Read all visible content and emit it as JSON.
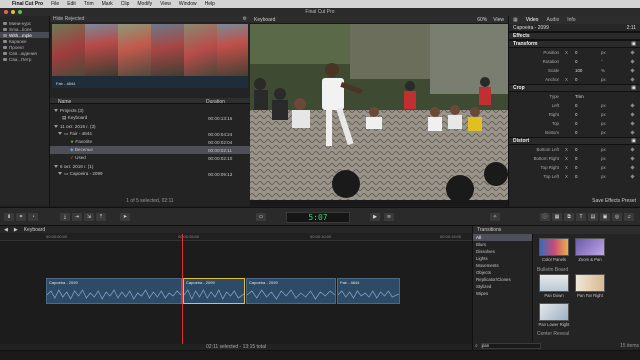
{
  "menubar": {
    "app": "Final Cut Pro",
    "items": [
      "File",
      "Edit",
      "Trim",
      "Mark",
      "Clip",
      "Modify",
      "View",
      "Window",
      "Help"
    ]
  },
  "window": {
    "title": "Final Cut Pro"
  },
  "sidebar": {
    "items": [
      "Мини-курс",
      "Sma...lions",
      "With...mple",
      "Караоке",
      "Проект",
      "Свя...ждения",
      "Сва...Петр"
    ]
  },
  "browser": {
    "header": "Hide Rejected",
    "filmstrip_label": "Fair - 4844",
    "columns": {
      "name": "Name",
      "duration": "Duration"
    },
    "rows": [
      {
        "name": "Projects (3)",
        "duration": ""
      },
      {
        "name": "Keyboard",
        "duration": "00:00:13:15"
      },
      {
        "name": "11 окт. 2016 г. (3)",
        "duration": ""
      },
      {
        "name": "Fair - 4844",
        "duration": "00:00:04:24"
      },
      {
        "name": "Favorite",
        "duration": "00:00:02:04"
      },
      {
        "name": "Веселье",
        "duration": "00:00:02:11"
      },
      {
        "name": "Used",
        "duration": "00:00:02:10"
      },
      {
        "name": "6 окт. 2016 г. (1)",
        "duration": ""
      },
      {
        "name": "Capoeira - 2099",
        "duration": "00:00:09:13"
      }
    ],
    "footer": "1 of 5 selected, 02:11"
  },
  "viewer": {
    "title": "Keyboard",
    "zoom": "60%",
    "view_label": "View"
  },
  "inspector": {
    "tabs": [
      "Video",
      "Audio",
      "Info"
    ],
    "clip_name": "Capoeira - 2099",
    "clip_duration": "2:11",
    "sections": {
      "effects": "Effects",
      "transform": "Transform",
      "crop": "Crop",
      "distort": "Distort"
    },
    "transform_params": [
      {
        "label": "Position",
        "axis": "X",
        "value": "0",
        "unit": "px"
      },
      {
        "label": "Rotation",
        "axis": "",
        "value": "0",
        "unit": "°"
      },
      {
        "label": "Scale",
        "axis": "",
        "value": "100",
        "unit": "%"
      },
      {
        "label": "Anchor",
        "axis": "X",
        "value": "0",
        "unit": "px"
      }
    ],
    "crop_params": [
      {
        "label": "Type",
        "axis": "",
        "value": "Trim",
        "unit": ""
      },
      {
        "label": "Left",
        "axis": "",
        "value": "0",
        "unit": "px"
      },
      {
        "label": "Right",
        "axis": "",
        "value": "0",
        "unit": "px"
      },
      {
        "label": "Top",
        "axis": "",
        "value": "0",
        "unit": "px"
      },
      {
        "label": "Bottom",
        "axis": "",
        "value": "0",
        "unit": "px"
      }
    ],
    "distort_params": [
      {
        "label": "Bottom Left",
        "axis": "X",
        "value": "0",
        "unit": "px"
      },
      {
        "label": "Bottom Right",
        "axis": "X",
        "value": "0",
        "unit": "px"
      },
      {
        "label": "Top Right",
        "axis": "X",
        "value": "0",
        "unit": "px"
      },
      {
        "label": "Top Left",
        "axis": "X",
        "value": "0",
        "unit": "px"
      }
    ],
    "save_preset": "Save Effects Preset"
  },
  "toolbar": {
    "timecode": "5:07"
  },
  "timeline": {
    "title": "Keyboard",
    "ruler": [
      "00:00:00:00",
      "00:00:05:00",
      "00:00:10:00",
      "00:00:15:00"
    ],
    "clips": [
      {
        "name": "Capoeira - 2099"
      },
      {
        "name": "Capoeira - 2099"
      },
      {
        "name": "Capoeira - 2099"
      },
      {
        "name": "Fair - 4844"
      }
    ],
    "status": "02:11 selected - 13:15 total"
  },
  "transitions": {
    "title": "Transitions",
    "categories": [
      "All",
      "Blurs",
      "Dissolves",
      "Lights",
      "Movements",
      "Objects",
      "Replicator/Clones",
      "Stylized",
      "Wipes"
    ],
    "group_label": "Bulletin Board",
    "group_label_2": "Center Reveal",
    "items": [
      {
        "name": "Color Panels"
      },
      {
        "name": "Zoom & Pan"
      },
      {
        "name": "Pan Down"
      },
      {
        "name": "Pan Far Right"
      },
      {
        "name": "Pan Lower Right"
      }
    ],
    "search_value": "pan",
    "count": "15 items"
  }
}
